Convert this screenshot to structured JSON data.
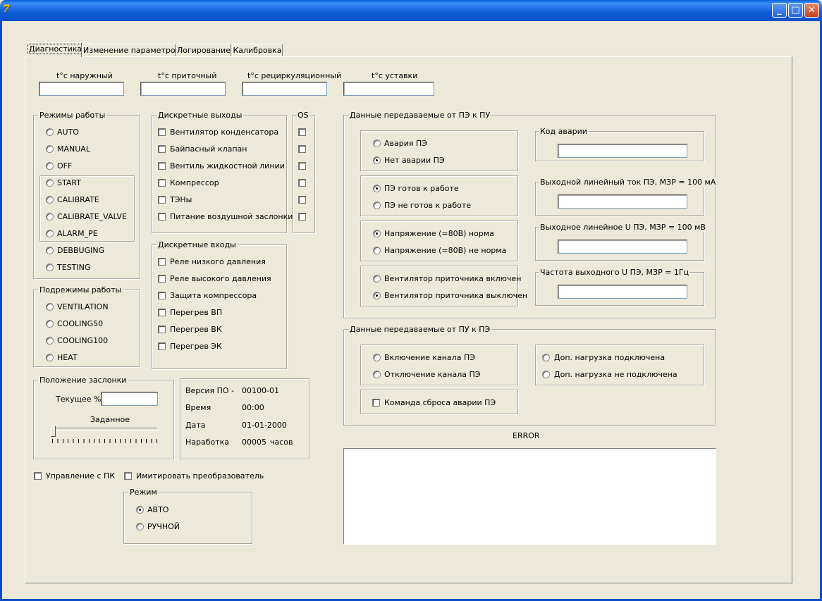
{
  "window": {
    "minimize_glyph": "_",
    "maximize_glyph": "□",
    "close_glyph": "✕",
    "app_icon": "app-icon"
  },
  "tabs": [
    {
      "label": "Диагностика",
      "active": true
    },
    {
      "label": "Изменение параметров",
      "active": false
    },
    {
      "label": "Логирование",
      "active": false
    },
    {
      "label": "Калибровка",
      "active": false
    }
  ],
  "temps": {
    "outdoor": "t°c наружный",
    "supply": "t°c приточный",
    "recirc": "t°c рециркуляционный",
    "setpoint": "t°c уставки"
  },
  "modes": {
    "title": "Режимы работы",
    "items": [
      "AUTO",
      "MANUAL",
      "OFF",
      "START",
      "CALIBRATE",
      "CALIBRATE_VALVE",
      "ALARM_PE",
      "DEBBUGING",
      "TESTING"
    ]
  },
  "submodes": {
    "title": "Подрежимы работы",
    "items": [
      "VENTILATION",
      "COOLING50",
      "COOLING100",
      "HEAT"
    ]
  },
  "discrete_out": {
    "title": "Дискретные выходы",
    "items": [
      "Вентилятор конденсатора",
      "Байпасный клапан",
      "Вентиль жидкостной линии",
      "Компрессор",
      "ТЭНы",
      "Питание воздушной заслонки"
    ]
  },
  "os": {
    "title": "OS"
  },
  "discrete_in": {
    "title": "Дискретные входы",
    "items": [
      "Реле низкого давления",
      "Реле высокого давления",
      "Защита компрессора",
      "Перегрев ВП",
      "Перегрев ВК",
      "Перегрев ЭК"
    ]
  },
  "damper": {
    "title": "Положение заслонки",
    "current_label": "Текущее %",
    "target_label": "Заданное",
    "target_value": 0
  },
  "info": {
    "version_label": "Версия ПО -",
    "version_value": "00100-01",
    "time_label": "Время",
    "time_value": "00:00",
    "date_label": "Дата",
    "date_value": "01-01-2000",
    "runtime_label": "Наработка",
    "runtime_value": "00005",
    "runtime_unit": "часов"
  },
  "pc_control": "Управление с ПК",
  "simulate": "Имитировать преобразователь",
  "regime": {
    "title": "Режим",
    "auto": "АВТО",
    "manual": "РУЧНОЙ",
    "selected": "АВТО"
  },
  "pe_to_pu": {
    "title": "Данные передаваемые от ПЭ к ПУ",
    "alarm": "Авария ПЭ",
    "no_alarm": "Нет аварии ПЭ",
    "alarm_selected": "no_alarm",
    "ready": "ПЭ готов к работе",
    "not_ready": "ПЭ не готов к работе",
    "ready_selected": "ready",
    "volt_ok": "Напряжение (=80В) норма",
    "volt_bad": "Напряжение (=80В) не норма",
    "volt_selected": "ok",
    "fan_on": "Вентилятор приточника включен",
    "fan_off": "Вентилятор приточника выключен",
    "fan_selected": "off",
    "alarm_code": "Код аварии",
    "out_current": "Выходной линейный ток ПЭ, МЗР = 100 мА",
    "out_voltage": "Выходное линейное U ПЭ, МЗР = 100 мВ",
    "out_freq": "Частота выходного U ПЭ, МЗР = 1Гц"
  },
  "pu_to_pe": {
    "title": "Данные передаваемые от ПУ к ПЭ",
    "ch_on": "Включение канала ПЭ",
    "ch_off": "Отключение канала ПЭ",
    "load_on": "Доп. нагрузка подключена",
    "load_off": "Доп. нагрузка не подключена",
    "reset": "Команда сброса аварии ПЭ"
  },
  "error_label": "ERROR",
  "colors": {
    "titlebar": "#0a5fd8",
    "face": "#ece9d8",
    "field": "#ffffff"
  }
}
